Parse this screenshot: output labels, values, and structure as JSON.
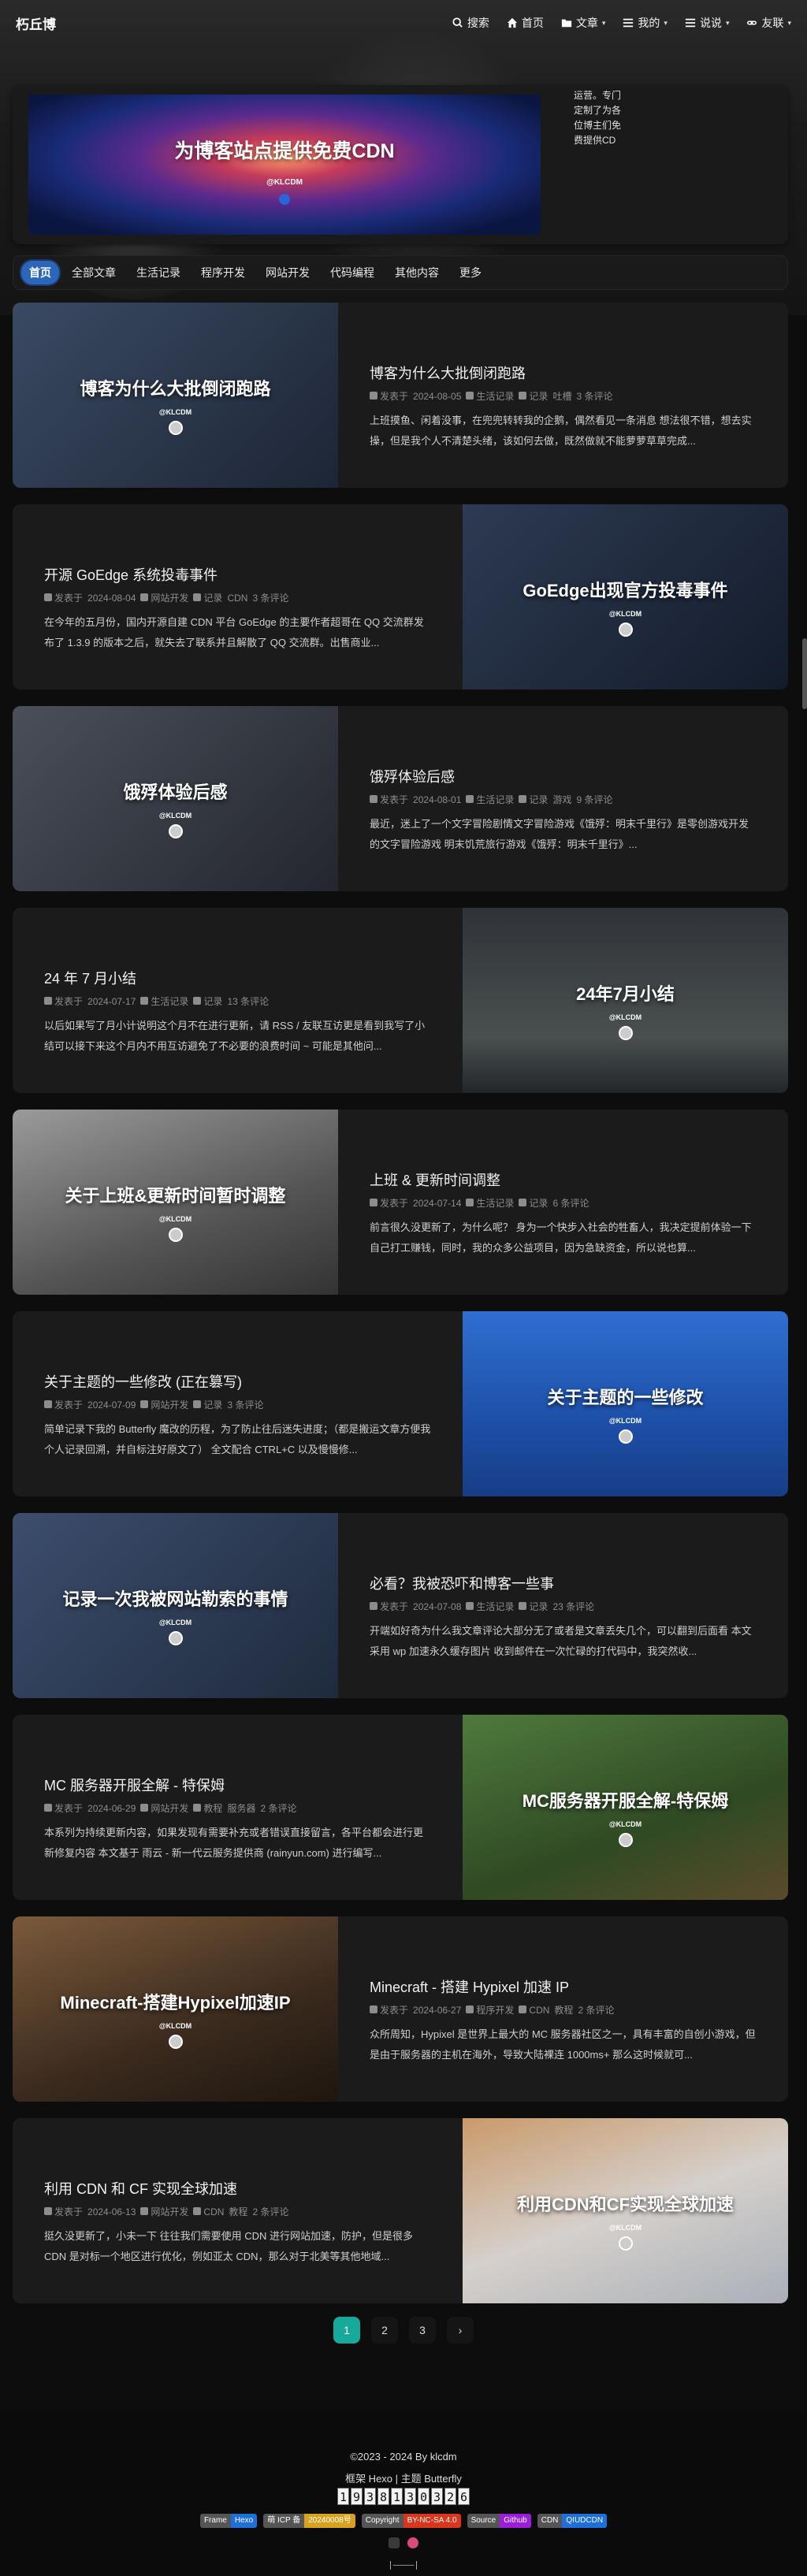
{
  "site": {
    "logo": "朽丘博"
  },
  "nav": {
    "items": [
      {
        "label": "搜索",
        "icon": "search-icon"
      },
      {
        "label": "首页",
        "icon": "home-icon"
      },
      {
        "label": "文章",
        "icon": "folder-icon",
        "dropdown": true
      },
      {
        "label": "我的",
        "icon": "list-icon",
        "dropdown": true
      },
      {
        "label": "说说",
        "icon": "list-icon",
        "dropdown": true
      },
      {
        "label": "友联",
        "icon": "link-icon",
        "dropdown": true
      }
    ]
  },
  "banner": {
    "title": "为博客站点提供免费CDN",
    "brand": "@KLCDM",
    "side_text": "运营。专门定制了为各位博主们免费提供CD"
  },
  "categories": [
    {
      "label": "首页",
      "active": true
    },
    {
      "label": "全部文章"
    },
    {
      "label": "生活记录"
    },
    {
      "label": "程序开发"
    },
    {
      "label": "网站开发"
    },
    {
      "label": "代码编程"
    },
    {
      "label": "其他内容"
    },
    {
      "label": "更多"
    }
  ],
  "posts": [
    {
      "title": "博客为什么大批倒闭跑路",
      "cover_text": "博客为什么大批倒闭跑路",
      "cover_brand": "@KLCDM",
      "meta": [
        "发表于",
        "2024-08-05",
        "生活记录",
        "记录",
        "吐槽",
        "3 条评论"
      ],
      "excerpt": "上班摸鱼、闲着没事，在兜兜转转我的企鹅，偶然看见一条消息 想法很不错，想去实操，但是我个人不清楚头绪，该如何去做，既然做就不能萝萝草草完成..."
    },
    {
      "title": "开源 GoEdge 系统投毒事件",
      "cover_text": "GoEdge出现官方投毒事件",
      "cover_brand": "@KLCDM",
      "meta": [
        "发表于",
        "2024-08-04",
        "网站开发",
        "记录",
        "CDN",
        "3 条评论"
      ],
      "excerpt": "在今年的五月份，国内开源自建 CDN 平台 GoEdge 的主要作者超哥在 QQ 交流群发布了 1.3.9 的版本之后，就失去了联系并且解散了 QQ 交流群。出售商业..."
    },
    {
      "title": "饿殍体验后感",
      "cover_text": "饿殍体验后感",
      "cover_brand": "@KLCDM",
      "meta": [
        "发表于",
        "2024-08-01",
        "生活记录",
        "记录",
        "游戏",
        "9 条评论"
      ],
      "excerpt": "最近，迷上了一个文字冒险剧情文字冒险游戏《饿殍：明末千里行》是零创游戏开发的文字冒险游戏 明末饥荒旅行游戏《饿殍：明末千里行》..."
    },
    {
      "title": "24 年 7 月小结",
      "cover_text": "24年7月小结",
      "cover_brand": "@KLCDM",
      "meta": [
        "发表于",
        "2024-07-17",
        "生活记录",
        "记录",
        "13 条评论"
      ],
      "excerpt": "以后如果写了月小计说明这个月不在进行更新，请 RSS / 友联互访更是看到我写了小结可以接下来这个月内不用互访避免了不必要的浪费时间 ~ 可能是其他问..."
    },
    {
      "title": "上班 & 更新时间调整",
      "cover_text": "关于上班&更新时间暂时调整",
      "cover_brand": "@KLCDM",
      "meta": [
        "发表于",
        "2024-07-14",
        "生活记录",
        "记录",
        "6 条评论"
      ],
      "excerpt": "前言很久没更新了，为什么呢？ 身为一个快步入社会的牲畜人，我决定提前体验一下自己打工赚钱，同时，我的众多公益项目，因为急缺资金，所以说也算..."
    },
    {
      "title": "关于主题的一些修改 (正在篡写)",
      "cover_text": "关于主题的一些修改",
      "cover_brand": "@KLCDM",
      "meta": [
        "发表于",
        "2024-07-09",
        "网站开发",
        "记录",
        "3 条评论"
      ],
      "excerpt": "简单记录下我的 Butterfly 魔改的历程，为了防止往后迷失进度；（都是搬运文章方便我个人记录回溯，并自标注好原文了） 全文配合 CTRL+C 以及慢慢修..."
    },
    {
      "title": "必看？我被恐吓和博客一些事",
      "cover_text": "记录一次我被网站勒索的事情",
      "cover_brand": "@KLCDM",
      "meta": [
        "发表于",
        "2024-07-08",
        "生活记录",
        "记录",
        "23 条评论"
      ],
      "excerpt": "开端如好奇为什么我文章评论大部分无了或者是文章丢失几个，可以翻到后面看 本文采用 wp 加速永久缓存图片 收到邮件在一次忙碌的打代码中，我突然收..."
    },
    {
      "title": "MC 服务器开服全解 - 特保姆",
      "cover_text": "MC服务器开服全解-特保姆",
      "cover_brand": "@KLCDM",
      "meta": [
        "发表于",
        "2024-06-29",
        "网站开发",
        "教程",
        "服务器",
        "2 条评论"
      ],
      "excerpt": "本系列为持续更新内容，如果发现有需要补充或者错误直接留言，各平台都会进行更新修复内容 本文基于 雨云 - 新一代云服务提供商 (rainyun.com) 进行编写..."
    },
    {
      "title": "Minecraft - 搭建 Hypixel 加速 IP",
      "cover_text": "Minecraft-搭建Hypixel加速IP",
      "cover_brand": "@KLCDM",
      "meta": [
        "发表于",
        "2024-06-27",
        "程序开发",
        "CDN",
        "教程",
        "2 条评论"
      ],
      "excerpt": "众所周知，Hypixel 是世界上最大的 MC 服务器社区之一，具有丰富的自创小游戏，但是由于服务器的主机在海外，导致大陆裸连 1000ms+ 那么这时候就可..."
    },
    {
      "title": "利用 CDN 和 CF 实现全球加速",
      "cover_text": "利用CDN和CF实现全球加速",
      "cover_brand": "@KLCDM",
      "meta": [
        "发表于",
        "2024-06-13",
        "网站开发",
        "CDN",
        "教程",
        "2 条评论"
      ],
      "excerpt": "挺久没更新了，小未一下 往往我们需要使用 CDN 进行网站加速，防护，但是很多 CDN 是对标一个地区进行优化，例如亚太 CDN，那么对于北美等其他地域..."
    }
  ],
  "pagination": {
    "pages": [
      "1",
      "2",
      "3"
    ],
    "active": "1",
    "next": "›"
  },
  "footer": {
    "copyright": "©2023 - 2024 By klcdm",
    "framework": "框架 Hexo | 主题 Butterfly",
    "counter": [
      "1",
      "9",
      "3",
      "8",
      "1",
      "3",
      "0",
      "3",
      "2",
      "6"
    ],
    "badges": [
      {
        "a": "Frame",
        "b": "Hexo",
        "color": "#1e6fd9"
      },
      {
        "a": "萌 ICP 备",
        "b": "20240008号",
        "color": "#d9a21e"
      },
      {
        "a": "Copyright",
        "b": "BY-NC-SA 4.0",
        "color": "#d9361e"
      },
      {
        "a": "Source",
        "b": "Github",
        "color": "#9c1ed9"
      },
      {
        "a": "CDN",
        "b": "QIUDCDN",
        "color": "#1e6fd9"
      }
    ],
    "divider": "|————|"
  }
}
